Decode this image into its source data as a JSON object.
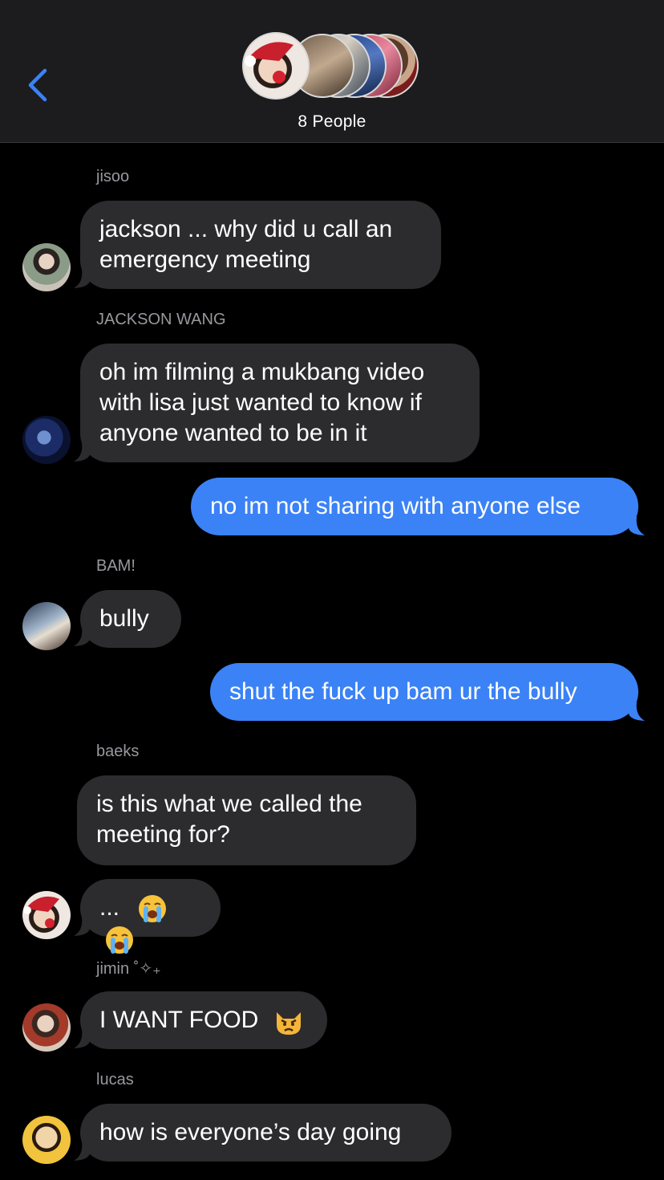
{
  "header": {
    "participants_label": "8 People"
  },
  "colors": {
    "incoming_bubble": "#2c2c2e",
    "outgoing_bubble": "#3a82f6",
    "accent": "#3a82f6",
    "sender_name": "#98989e"
  },
  "messages": [
    {
      "sender": "jisoo",
      "lines": [
        "jackson ... why did u call an",
        "emergency meeting"
      ]
    },
    {
      "sender": "JACKSON WANG",
      "lines": [
        "oh im filming a mukbang video",
        "with lisa just wanted to know if",
        "anyone wanted to be in it"
      ]
    },
    {
      "sender": "",
      "lines": [
        "no im not sharing with anyone else"
      ]
    },
    {
      "sender": "BAM!",
      "lines": [
        "bully"
      ]
    },
    {
      "sender": "",
      "lines": [
        "shut the fuck up bam ur the bully"
      ]
    },
    {
      "sender": "baeks",
      "lines": [
        "is this what we called the",
        "meeting for?"
      ]
    },
    {
      "sender": "",
      "lines": [
        "..."
      ]
    },
    {
      "sender": "jimin ˚✧₊",
      "lines": [
        "I WANT FOOD"
      ]
    },
    {
      "sender": "lucas",
      "lines": [
        "how is everyone’s day going"
      ]
    }
  ],
  "icons": {
    "back": "chevron-left-icon",
    "crying_emoji": "loudly-crying-face",
    "pouting_cat_emoji": "pouting-cat-face"
  }
}
